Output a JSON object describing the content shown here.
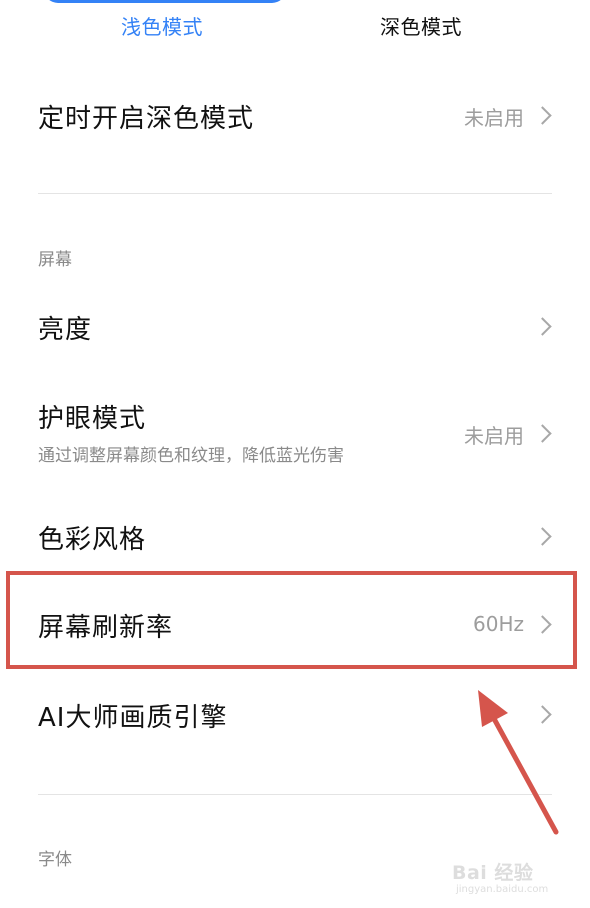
{
  "mode_tabs": {
    "light": "浅色模式",
    "dark": "深色模式"
  },
  "scheduled_dark": {
    "title": "定时开启深色模式",
    "value": "未启用"
  },
  "screen_section": {
    "header": "屏幕",
    "items": [
      {
        "title": "亮度",
        "value": ""
      },
      {
        "title": "护眼模式",
        "subtitle": "通过调整屏幕颜色和纹理，降低蓝光伤害",
        "value": "未启用"
      },
      {
        "title": "色彩风格",
        "value": ""
      },
      {
        "title": "屏幕刷新率",
        "value": "60Hz"
      },
      {
        "title": "AI大师画质引擎",
        "value": ""
      }
    ]
  },
  "font_section": {
    "header": "字体"
  },
  "watermark": {
    "logo_text": "Bai 经验",
    "url": "jingyan.baidu.com"
  },
  "colors": {
    "accent": "#3482f6",
    "annotation": "#d5554c"
  },
  "icons": [
    "chevron-right-icon",
    "annotation-arrow"
  ]
}
